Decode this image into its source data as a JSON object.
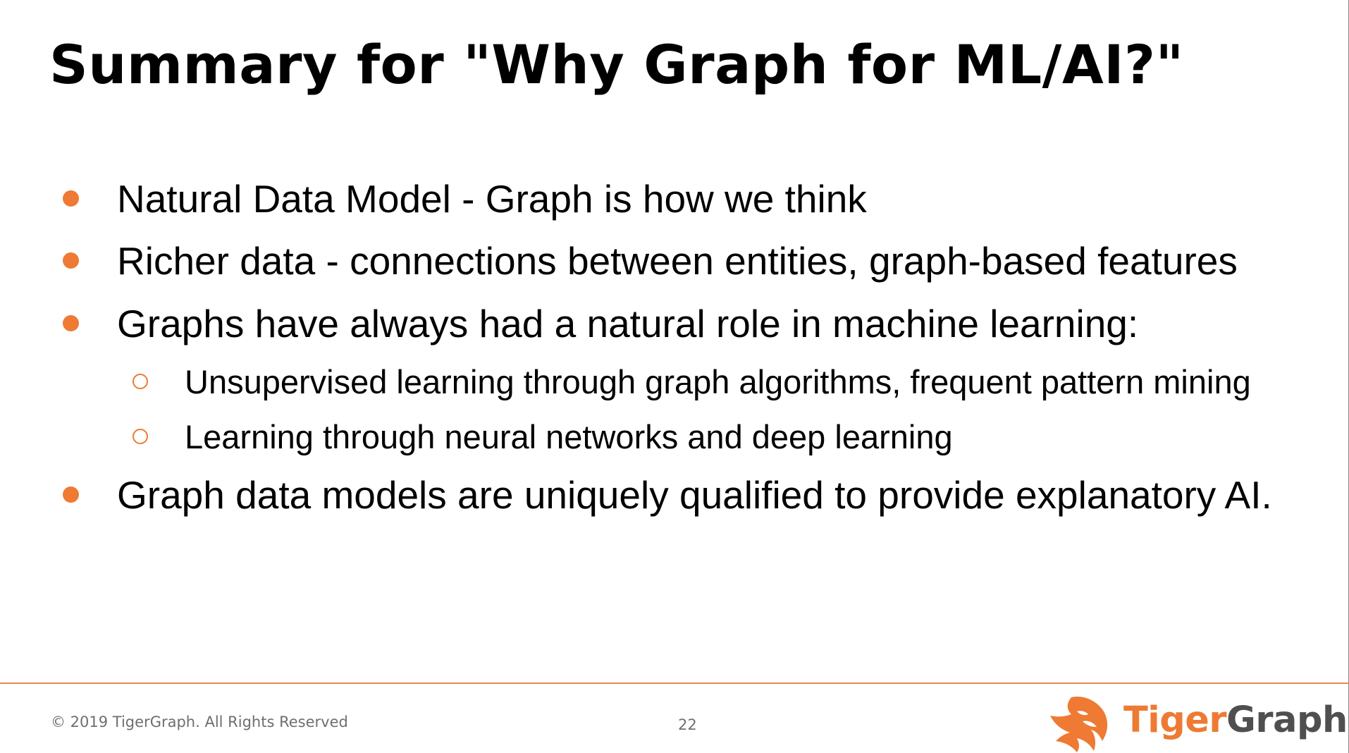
{
  "slide": {
    "title": "Summary for \"Why Graph for ML/AI?\"",
    "bullets": [
      {
        "level": 1,
        "text": "Natural Data Model - Graph is how we think"
      },
      {
        "level": 1,
        "text": "Richer data - connections between entities, graph-based features"
      },
      {
        "level": 1,
        "text": "Graphs have always had a natural role in machine learning:"
      },
      {
        "level": 2,
        "text": "Unsupervised learning through graph algorithms, frequent pattern mining"
      },
      {
        "level": 2,
        "text": "Learning through neural networks and deep learning"
      },
      {
        "level": 1,
        "text": "Graph data models are uniquely qualified to provide explanatory AI."
      }
    ]
  },
  "footer": {
    "copyright": "© 2019 TigerGraph. All Rights Reserved",
    "page_number": "22",
    "logo": {
      "word_tiger": "Tiger",
      "word_graph": "Graph",
      "icon": "tiger-head-icon"
    }
  },
  "colors": {
    "accent": "#ee7a33",
    "logo_text_dark": "#4f4f4f",
    "footer_text": "#6f6f6f",
    "text": "#000000"
  }
}
